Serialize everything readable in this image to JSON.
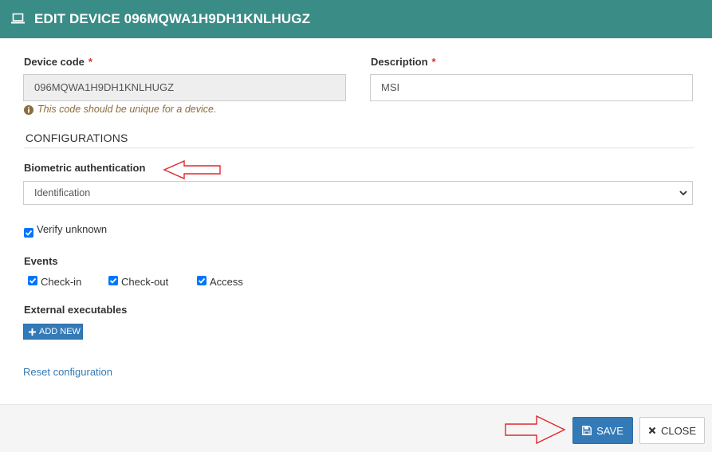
{
  "dialog": {
    "title": "EDIT DEVICE 096MQWA1H9DH1KNLHUGZ",
    "title_icon": "laptop-icon"
  },
  "form": {
    "device_code": {
      "label": "Device code",
      "required_mark": "*",
      "value": "096MQWA1H9DH1KNLHUGZ",
      "help_text": "This code should be unique for a device.",
      "help_icon": "info-circle-icon"
    },
    "description": {
      "label": "Description",
      "required_mark": "*",
      "value": "MSI"
    },
    "configurations": {
      "section_title": "CONFIGURATIONS",
      "biometric": {
        "label": "Biometric authentication",
        "selected": "Identification"
      },
      "verify_unknown": {
        "label": "Verify unknown",
        "checked": true
      },
      "events": {
        "label": "Events",
        "items": [
          {
            "label": "Check-in",
            "checked": true
          },
          {
            "label": "Check-out",
            "checked": true
          },
          {
            "label": "Access",
            "checked": true
          }
        ]
      },
      "external_executables": {
        "label": "External executables",
        "add_button": "ADD NEW"
      },
      "reset_link": "Reset configuration"
    }
  },
  "footer": {
    "save_label": "SAVE",
    "close_label": "CLOSE"
  },
  "colors": {
    "header": "#3a8c87",
    "primary_button": "#337ab7",
    "required": "#d9342b",
    "help_text": "#8a6d3b",
    "annotation_arrow": "#e0282e"
  }
}
